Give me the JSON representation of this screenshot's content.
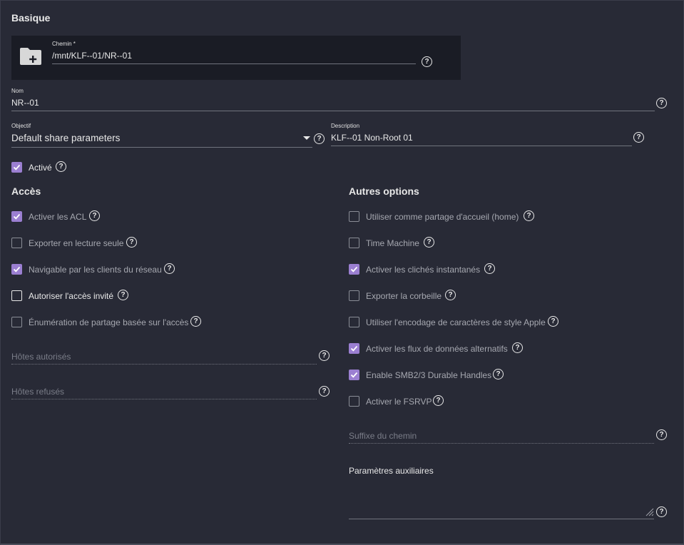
{
  "basic": {
    "title": "Basique",
    "path": {
      "label": "Chemin *",
      "value": "/mnt/KLF--01/NR--01"
    },
    "name": {
      "label": "Nom",
      "value": "NR--01"
    },
    "purpose": {
      "label": "Objectif",
      "value": "Default share parameters"
    },
    "description": {
      "label": "Description",
      "value": "KLF--01 Non-Root 01"
    },
    "enabled": {
      "label": "Activé",
      "checked": true
    }
  },
  "access": {
    "title": "Accès",
    "options": [
      {
        "label": "Activer les ACL",
        "checked": true
      },
      {
        "label": "Exporter en lecture seule",
        "checked": false
      },
      {
        "label": "Navigable par les clients du réseau",
        "checked": true
      },
      {
        "label": "Autoriser l'accès invité",
        "checked": false
      },
      {
        "label": "Énumération de partage basée sur l'accès",
        "checked": false
      }
    ],
    "allowed_hosts_placeholder": "Hôtes autorisés",
    "denied_hosts_placeholder": "Hôtes refusés"
  },
  "other": {
    "title": "Autres options",
    "options": [
      {
        "label": "Utiliser comme partage d'accueil (home)",
        "checked": false
      },
      {
        "label": "Time Machine",
        "checked": false
      },
      {
        "label": "Activer les clichés instantanés",
        "checked": true
      },
      {
        "label": "Exporter la corbeille",
        "checked": false
      },
      {
        "label": "Utiliser l'encodage de caractères de style Apple",
        "checked": false
      },
      {
        "label": "Activer les flux de données alternatifs",
        "checked": true
      },
      {
        "label": "Enable SMB2/3 Durable Handles",
        "checked": true
      },
      {
        "label": "Activer le FSRVP",
        "checked": false
      }
    ],
    "path_suffix_placeholder": "Suffixe du chemin",
    "aux_params_label": "Paramètres auxiliaires"
  },
  "help_glyph": "?",
  "colors": {
    "accent": "#9b7fd1",
    "background": "#282a36",
    "panel": "#1a1c25"
  }
}
